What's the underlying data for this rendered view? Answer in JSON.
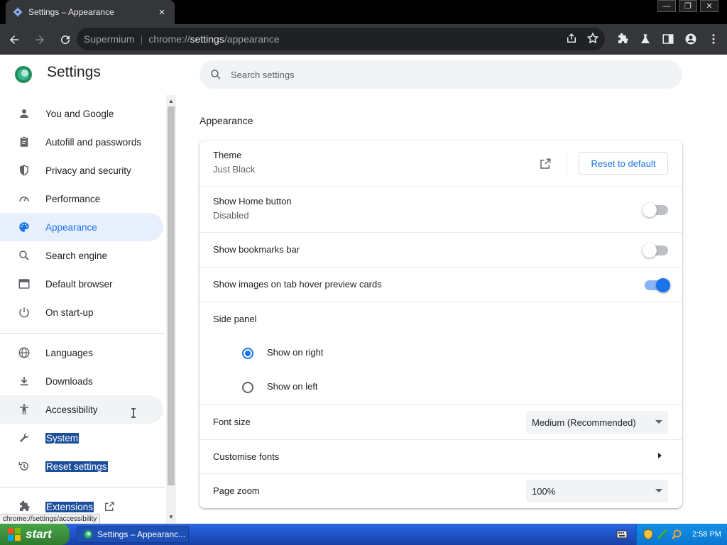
{
  "browser": {
    "tab_title": "Settings – Appearance",
    "tab_close": "×",
    "window_controls": [
      "—",
      "❐",
      "✕"
    ],
    "omnibox": {
      "origin_label": "Supermium",
      "separator": "|",
      "url_scheme": "chrome://",
      "url_host": "settings",
      "url_path": "/appearance"
    },
    "status_url": "chrome://settings/accessibility"
  },
  "header": {
    "title": "Settings",
    "search_placeholder": "Search settings"
  },
  "sidebar": {
    "items": [
      {
        "label": "You and Google",
        "icon": "person-icon"
      },
      {
        "label": "Autofill and passwords",
        "icon": "clipboard-icon"
      },
      {
        "label": "Privacy and security",
        "icon": "shield-icon"
      },
      {
        "label": "Performance",
        "icon": "speedometer-icon"
      },
      {
        "label": "Appearance",
        "icon": "palette-icon"
      },
      {
        "label": "Search engine",
        "icon": "search-icon"
      },
      {
        "label": "Default browser",
        "icon": "browser-window-icon"
      },
      {
        "label": "On start-up",
        "icon": "power-icon"
      },
      {
        "label": "Languages",
        "icon": "globe-icon"
      },
      {
        "label": "Downloads",
        "icon": "download-icon"
      },
      {
        "label": "Accessibility",
        "icon": "accessibility-icon"
      },
      {
        "label": "System",
        "icon": "wrench-icon"
      },
      {
        "label": "Reset settings",
        "icon": "history-icon"
      },
      {
        "label": "Extensions",
        "icon": "puzzle-icon"
      }
    ],
    "selected": "Appearance"
  },
  "main": {
    "section_title": "Appearance",
    "theme": {
      "label": "Theme",
      "value": "Just Black",
      "reset_label": "Reset to default"
    },
    "home_button": {
      "label": "Show Home button",
      "value": "Disabled",
      "enabled": false
    },
    "bookmarks_bar": {
      "label": "Show bookmarks bar",
      "enabled": false
    },
    "tab_hover": {
      "label": "Show images on tab hover preview cards",
      "enabled": true
    },
    "side_panel": {
      "label": "Side panel",
      "options": [
        "Show on right",
        "Show on left"
      ],
      "selected": "Show on right"
    },
    "font_size": {
      "label": "Font size",
      "value": "Medium (Recommended)"
    },
    "customise_fonts": {
      "label": "Customise fonts"
    },
    "page_zoom": {
      "label": "Page zoom",
      "value": "100%"
    }
  },
  "taskbar": {
    "start_label": "start",
    "task_label": "Settings – Appearanc...",
    "clock": "2:58 PM"
  },
  "colors": {
    "accent": "#1a73e8",
    "selected_bg": "#e8f0fe",
    "toolbar": "#35363a",
    "taskbar": "#245edb",
    "start_button": "#3c8f3c"
  }
}
